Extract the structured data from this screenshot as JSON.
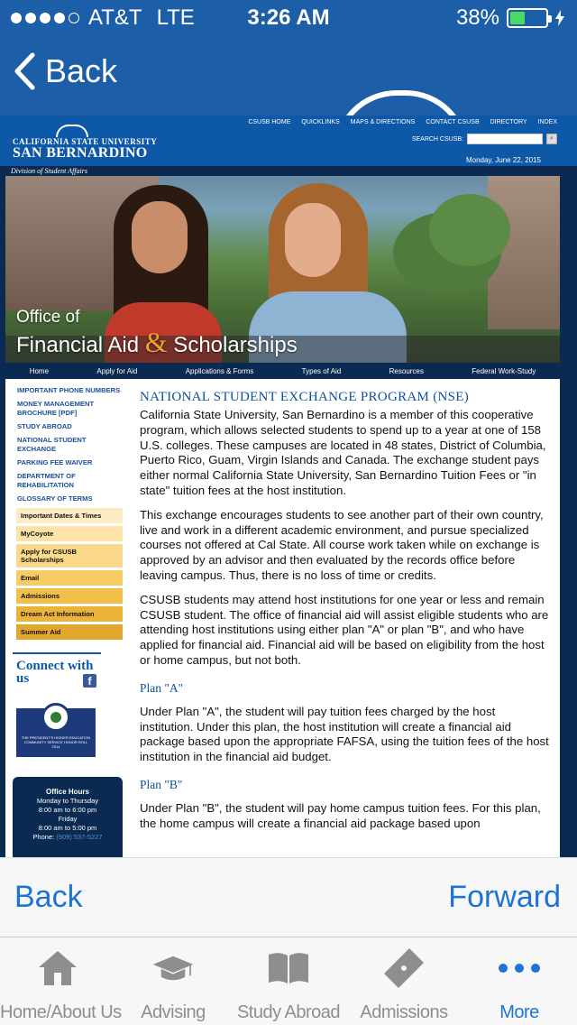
{
  "status": {
    "carrier": "AT&T",
    "network": "LTE",
    "time": "3:26 AM",
    "battery": "38%",
    "battery_level": 0.38
  },
  "nav": {
    "back_label": "Back"
  },
  "site": {
    "logo_line1": "CALIFORNIA STATE UNIVERSITY",
    "logo_line2": "SAN BERNARDINO",
    "toplinks": [
      "CSUSB HOME",
      "QUICKLINKS",
      "MAPS & DIRECTIONS",
      "CONTACT CSUSB",
      "DIRECTORY",
      "INDEX"
    ],
    "search_label": "SEARCH CSUSB:",
    "date": "Monday, June 22, 2015",
    "division": "Division of Student Affairs",
    "hero_title1": "Office of",
    "hero_title2a": "Financial Aid ",
    "hero_amp": "&",
    "hero_title2b": " Scholarships",
    "menu": [
      "Home",
      "Apply for Aid",
      "Applications & Forms",
      "Types of Aid",
      "Resources",
      "Federal Work-Study"
    ]
  },
  "sidebar": {
    "links": [
      "IMPORTANT PHONE NUMBERS",
      "MONEY MANAGEMENT BROCHURE [PDF]",
      "STUDY ABROAD",
      "NATIONAL STUDENT EXCHANGE",
      "PARKING FEE WAIVER",
      "DEPARTMENT OF REHABILITATION",
      "GLOSSARY OF TERMS"
    ],
    "buttons": [
      {
        "label": "Important Dates & Times",
        "color": "#fdebc4"
      },
      {
        "label": "MyCoyote",
        "color": "#fde3a8"
      },
      {
        "label": "Apply for CSUSB Scholarships",
        "color": "#fbd98a"
      },
      {
        "label": "Email",
        "color": "#f7cc64"
      },
      {
        "label": "Admissions",
        "color": "#f2bf48"
      },
      {
        "label": "Dream Act Information",
        "color": "#eab33a"
      },
      {
        "label": "Summer Aid",
        "color": "#e2a82e"
      }
    ],
    "connect": "Connect with us",
    "fb": "f",
    "seal_text": "THE PRESIDENT'S HIGHER EDUCATION COMMUNITY SERVICE HONOR ROLL 2014",
    "hours_title": "Office Hours",
    "hours_days1": "Monday to Thursday",
    "hours_time1": "8:00 am to 6:00 pm",
    "hours_days2": "Friday",
    "hours_time2": "8:00 am to 5:00 pm",
    "hours_phone_label": "Phone: ",
    "hours_phone": "(909) 537-5227"
  },
  "content": {
    "heading": "NATIONAL STUDENT EXCHANGE PROGRAM (NSE)",
    "p1": "California State University, San Bernardino is a member of this cooperative program, which allows selected students to spend up to a year at one of 158 U.S. colleges. These campuses are located in 48 states, District of Columbia, Puerto Rico, Guam, Virgin Islands and Canada. The exchange student pays either normal California State University, San Bernardino Tuition Fees or \"in state\" tuition fees at the host institution.",
    "p2": "This exchange encourages students to see another part of their own country, live and work in a different academic environment, and pursue specialized courses not offered at Cal State. All course work taken while on exchange is approved by an advisor and then evaluated by the records office before leaving campus. Thus, there is no loss of time or credits.",
    "p3": "CSUSB students may attend host institutions for one year or less and remain CSUSB student. The office of financial aid will assist eligible students who are attending host institutions using either plan \"A\" or plan \"B\", and who have applied for financial aid. Financial aid will be based on eligibility from the host or home campus, but not both.",
    "planA_title": "Plan \"A\"",
    "planA": "Under Plan \"A\", the student will pay tuition fees charged by the host institution. Under this plan, the host institution will create a financial aid package based upon the appropriate FAFSA, using the tuition fees of the host institution in the financial aid budget.",
    "planB_title": "Plan \"B\"",
    "planB": "Under Plan \"B\", the student will pay home campus tuition fees. For this plan, the home campus will create a financial aid package based upon"
  },
  "toolbar": {
    "back": "Back",
    "forward": "Forward"
  },
  "tabs": [
    {
      "label": "Home/About Us",
      "icon": "home-icon"
    },
    {
      "label": "Advising",
      "icon": "graduation-cap-icon"
    },
    {
      "label": "Study Abroad",
      "icon": "book-icon"
    },
    {
      "label": "Admissions",
      "icon": "ticket-icon"
    },
    {
      "label": "More",
      "icon": "more-icon"
    }
  ],
  "colors": {
    "brand_blue": "#1c5fa8",
    "ios_tint": "#1b74d4",
    "site_navy": "#0b2a52"
  }
}
